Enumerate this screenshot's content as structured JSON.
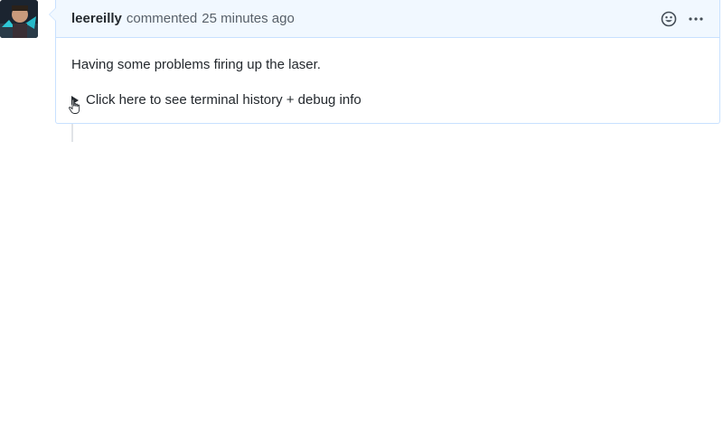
{
  "comment": {
    "author": "leereilly",
    "verb": "commented",
    "timestamp": "25 minutes ago",
    "body": "Having some problems firing up the laser.",
    "details_summary": "Click here to see terminal history + debug info"
  },
  "icons": {
    "avatar": "user-avatar",
    "reaction": "smiley-icon",
    "more": "kebab-horizontal-icon",
    "disclosure": "triangle-right-icon",
    "cursor": "hand-pointer-icon"
  },
  "colors": {
    "header_bg": "#f1f8ff",
    "border": "#c8e1ff",
    "text": "#24292e",
    "muted": "#586069"
  }
}
